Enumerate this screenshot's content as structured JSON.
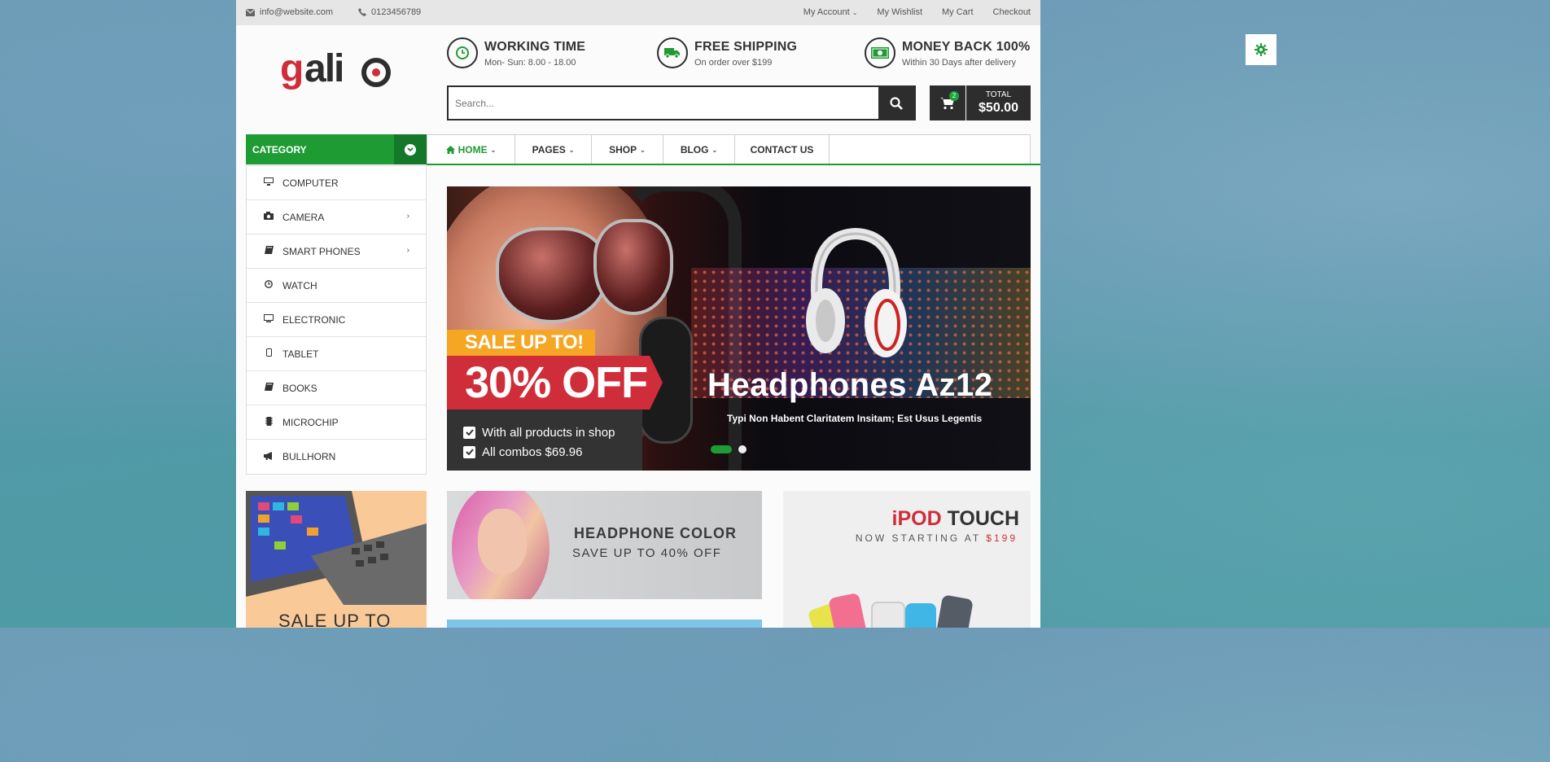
{
  "topbar": {
    "email": "info@website.com",
    "phone": "0123456789",
    "links": [
      "My Account",
      "My Wishlist",
      "My Cart",
      "Checkout"
    ]
  },
  "logo": {
    "text": "galio"
  },
  "features": [
    {
      "title": "WORKING TIME",
      "subtitle": "Mon- Sun: 8.00 - 18.00",
      "icon": "clock-icon"
    },
    {
      "title": "FREE SHIPPING",
      "subtitle": "On order over $199",
      "icon": "truck-icon"
    },
    {
      "title": "MONEY BACK 100%",
      "subtitle": "Within 30 Days after delivery",
      "icon": "money-icon"
    }
  ],
  "search": {
    "placeholder": "Search..."
  },
  "cart": {
    "count": "2",
    "total_label": "TOTAL",
    "total": "$50.00"
  },
  "category": {
    "header": "CATEGORY",
    "items": [
      {
        "label": "COMPUTER",
        "icon": "desktop-icon",
        "has_submenu": false
      },
      {
        "label": "CAMERA",
        "icon": "camera-icon",
        "has_submenu": true
      },
      {
        "label": "SMART PHONES",
        "icon": "book-icon",
        "has_submenu": true
      },
      {
        "label": "WATCH",
        "icon": "clock-icon",
        "has_submenu": false
      },
      {
        "label": "ELECTRONIC",
        "icon": "monitor-icon",
        "has_submenu": false
      },
      {
        "label": "TABLET",
        "icon": "tablet-icon",
        "has_submenu": false
      },
      {
        "label": "BOOKS",
        "icon": "book-icon",
        "has_submenu": false
      },
      {
        "label": "MICROCHIP",
        "icon": "chip-icon",
        "has_submenu": false
      },
      {
        "label": "BULLHORN",
        "icon": "bullhorn-icon",
        "has_submenu": false
      }
    ]
  },
  "nav": {
    "tabs": [
      {
        "label": "HOME",
        "active": true,
        "dropdown": true
      },
      {
        "label": "PAGES",
        "active": false,
        "dropdown": true
      },
      {
        "label": "SHOP",
        "active": false,
        "dropdown": true
      },
      {
        "label": "BLOG",
        "active": false,
        "dropdown": true
      },
      {
        "label": "CONTACT US",
        "active": false,
        "dropdown": false
      }
    ]
  },
  "slider": {
    "sale_line1": "SALE UP TO!",
    "sale_line2": "30% OFF",
    "bullets": [
      "With all products in shop",
      "All combos $69.96"
    ],
    "title": "Headphones Az12",
    "subtitle": "Typi Non Habent Claritatem Insitam; Est Usus Legentis"
  },
  "banners": {
    "laptop_text": "SALE UP TO",
    "headphone_title": "HEADPHONE COLOR",
    "headphone_sub": "SAVE UP TO 40% OFF",
    "ipod_title_red": "iPOD",
    "ipod_title": " TOUCH",
    "ipod_sub": "NOW STARTING AT ",
    "ipod_price": "$199"
  },
  "colors": {
    "accent": "#1e9b33",
    "dark": "#2d2d2d",
    "sale_red": "#d02d3a",
    "sale_orange": "#f5a623"
  }
}
